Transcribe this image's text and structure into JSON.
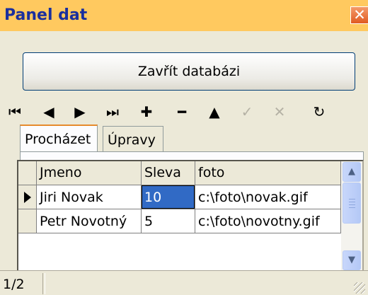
{
  "window": {
    "title": "Panel dat",
    "close_glyph": "✕"
  },
  "actions": {
    "close_db_label": "Zavřít databázi"
  },
  "navigator": {
    "buttons": [
      {
        "name": "first-record-icon",
        "glyph": "⏮",
        "enabled": true
      },
      {
        "name": "prior-record-icon",
        "glyph": "◀",
        "enabled": true
      },
      {
        "name": "next-record-icon",
        "glyph": "▶",
        "enabled": true
      },
      {
        "name": "last-record-icon",
        "glyph": "⏭",
        "enabled": true
      },
      {
        "name": "insert-record-icon",
        "glyph": "✚",
        "enabled": true
      },
      {
        "name": "delete-record-icon",
        "glyph": "━",
        "enabled": true
      },
      {
        "name": "edit-record-icon",
        "glyph": "▲",
        "enabled": true
      },
      {
        "name": "post-edit-icon",
        "glyph": "✓",
        "enabled": false
      },
      {
        "name": "cancel-edit-icon",
        "glyph": "✕",
        "enabled": false
      },
      {
        "name": "refresh-icon",
        "glyph": "↻",
        "enabled": true
      }
    ]
  },
  "tabs": [
    {
      "label": "Procházet",
      "active": true
    },
    {
      "label": "Úpravy",
      "active": false
    }
  ],
  "grid": {
    "columns": [
      "Jmeno",
      "Sleva",
      "foto"
    ],
    "rows": [
      {
        "current": true,
        "cells": [
          "Jiri Novak",
          "10",
          "c:\\foto\\novak.gif"
        ]
      },
      {
        "current": false,
        "cells": [
          "Petr Novotný",
          "5",
          "c:\\foto\\novotny.gif"
        ]
      }
    ],
    "selected_cell": {
      "row": 0,
      "col": 1
    }
  },
  "status": {
    "position": "1/2"
  }
}
